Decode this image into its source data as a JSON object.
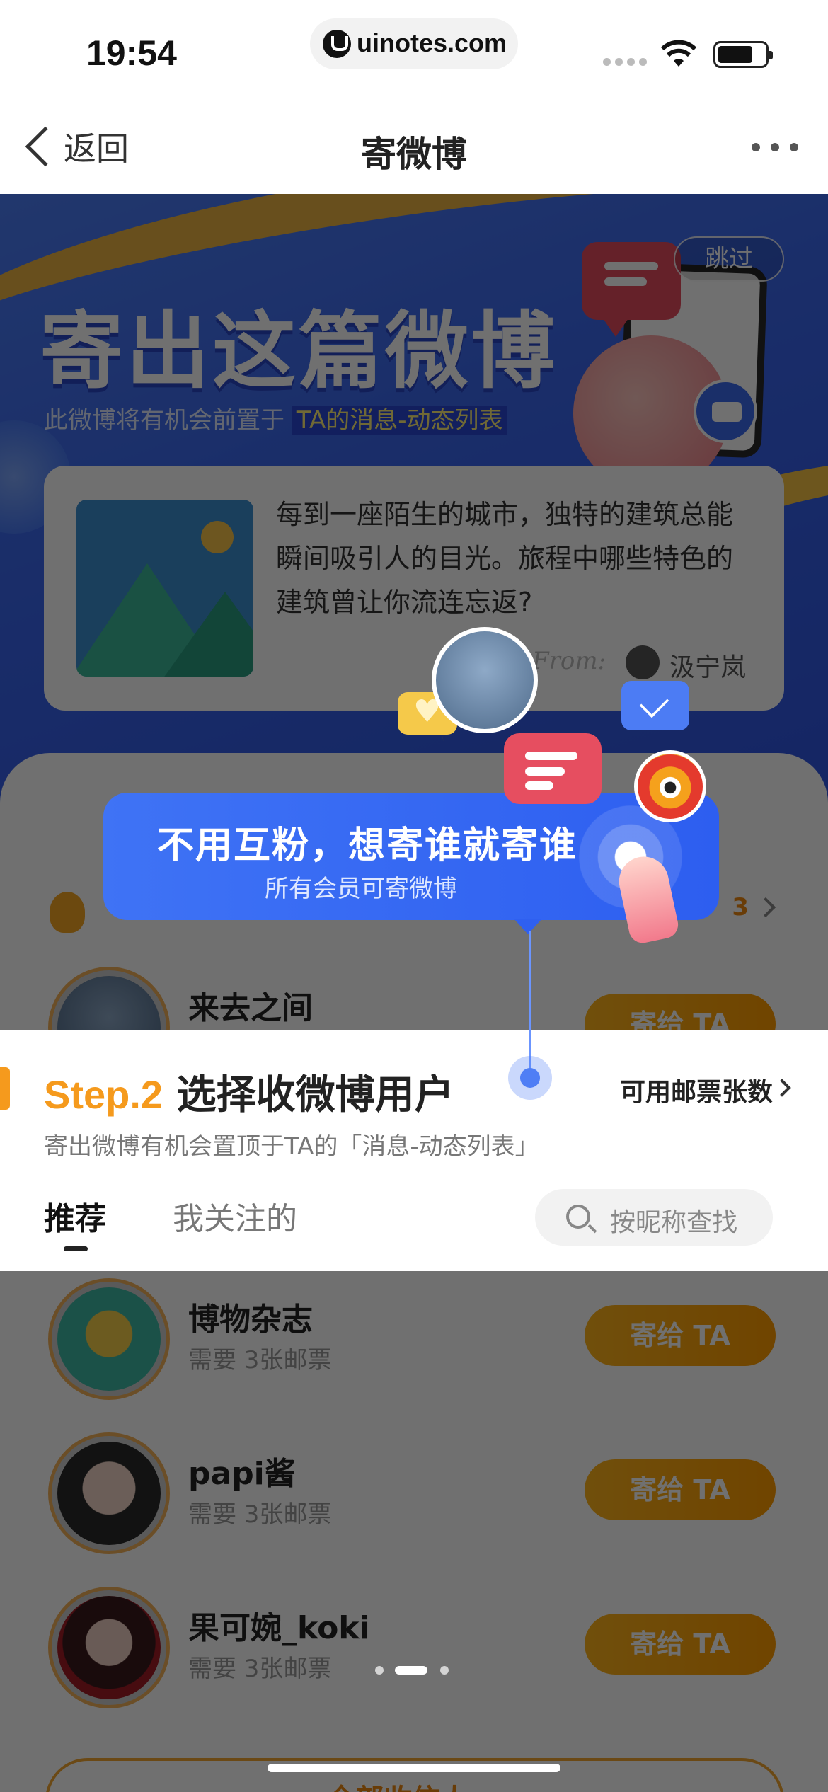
{
  "status_bar": {
    "time": "19:54",
    "url": "uinotes.com"
  },
  "nav": {
    "back_label": "返回",
    "title": "寄微博",
    "more_icon": "more-dots-icon"
  },
  "banner": {
    "title": "寄出这篇微博",
    "subtitle_prefix": "此微博将有机会前置于 ",
    "subtitle_highlight": "TA的消息-动态列表",
    "skip_label": "跳过",
    "card": {
      "text": "每到一座陌生的城市，独特的建筑总能瞬间吸引人的目光。旅程中哪些特色的建筑曾让你流连忘返?",
      "from_label": "From:",
      "author": "汲宁岚"
    }
  },
  "guide": {
    "title": "不用互粉，想寄谁就寄谁",
    "subtitle": "所有会员可寄微博"
  },
  "step": {
    "number": "Step.2",
    "title": "选择收微博用户",
    "stamps_label": "可用邮票张数",
    "description": "寄出微博有机会置顶于TA的「消息-动态列表」",
    "tabs": [
      {
        "label": "推荐",
        "active": true
      },
      {
        "label": "我关注的",
        "active": false
      }
    ],
    "search_placeholder": "按昵称查找"
  },
  "recipients_row": {
    "count": "3"
  },
  "users": [
    {
      "name": "来去之间",
      "sub": "",
      "button": "寄给 TA"
    },
    {
      "name": "博物杂志",
      "sub": "需要 3张邮票",
      "button": "寄给 TA"
    },
    {
      "name": "papi酱",
      "sub": "需要 3张邮票",
      "button": "寄给 TA"
    },
    {
      "name": "果可婉_koki",
      "sub": "需要 3张邮票",
      "button": "寄给 TA"
    }
  ],
  "all_recipients_label": "全部收信人 >",
  "pager": {
    "pages": 3,
    "active": 2
  },
  "colors": {
    "accent_orange": "#f59a1d",
    "guide_blue": "#3f73f5",
    "send_button": "#ffa60e"
  }
}
